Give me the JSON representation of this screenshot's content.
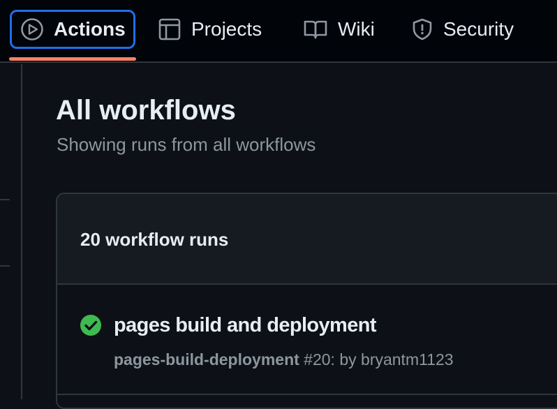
{
  "nav": {
    "tabs": [
      {
        "label": "Actions",
        "icon": "play-circle-icon",
        "active": true
      },
      {
        "label": "Projects",
        "icon": "table-icon",
        "active": false
      },
      {
        "label": "Wiki",
        "icon": "book-icon",
        "active": false
      },
      {
        "label": "Security",
        "icon": "shield-icon",
        "active": false
      }
    ]
  },
  "main": {
    "title": "All workflows",
    "subtitle": "Showing runs from all workflows"
  },
  "runs": {
    "count_label": "20 workflow runs",
    "items": [
      {
        "title": "pages build and deployment",
        "status": "success",
        "workflow": "pages-build-deployment",
        "run_info": " #20: by bryantm1123"
      }
    ]
  },
  "colors": {
    "accent_blue": "#1f6feb",
    "underline": "#f78166",
    "success": "#3fb950"
  }
}
